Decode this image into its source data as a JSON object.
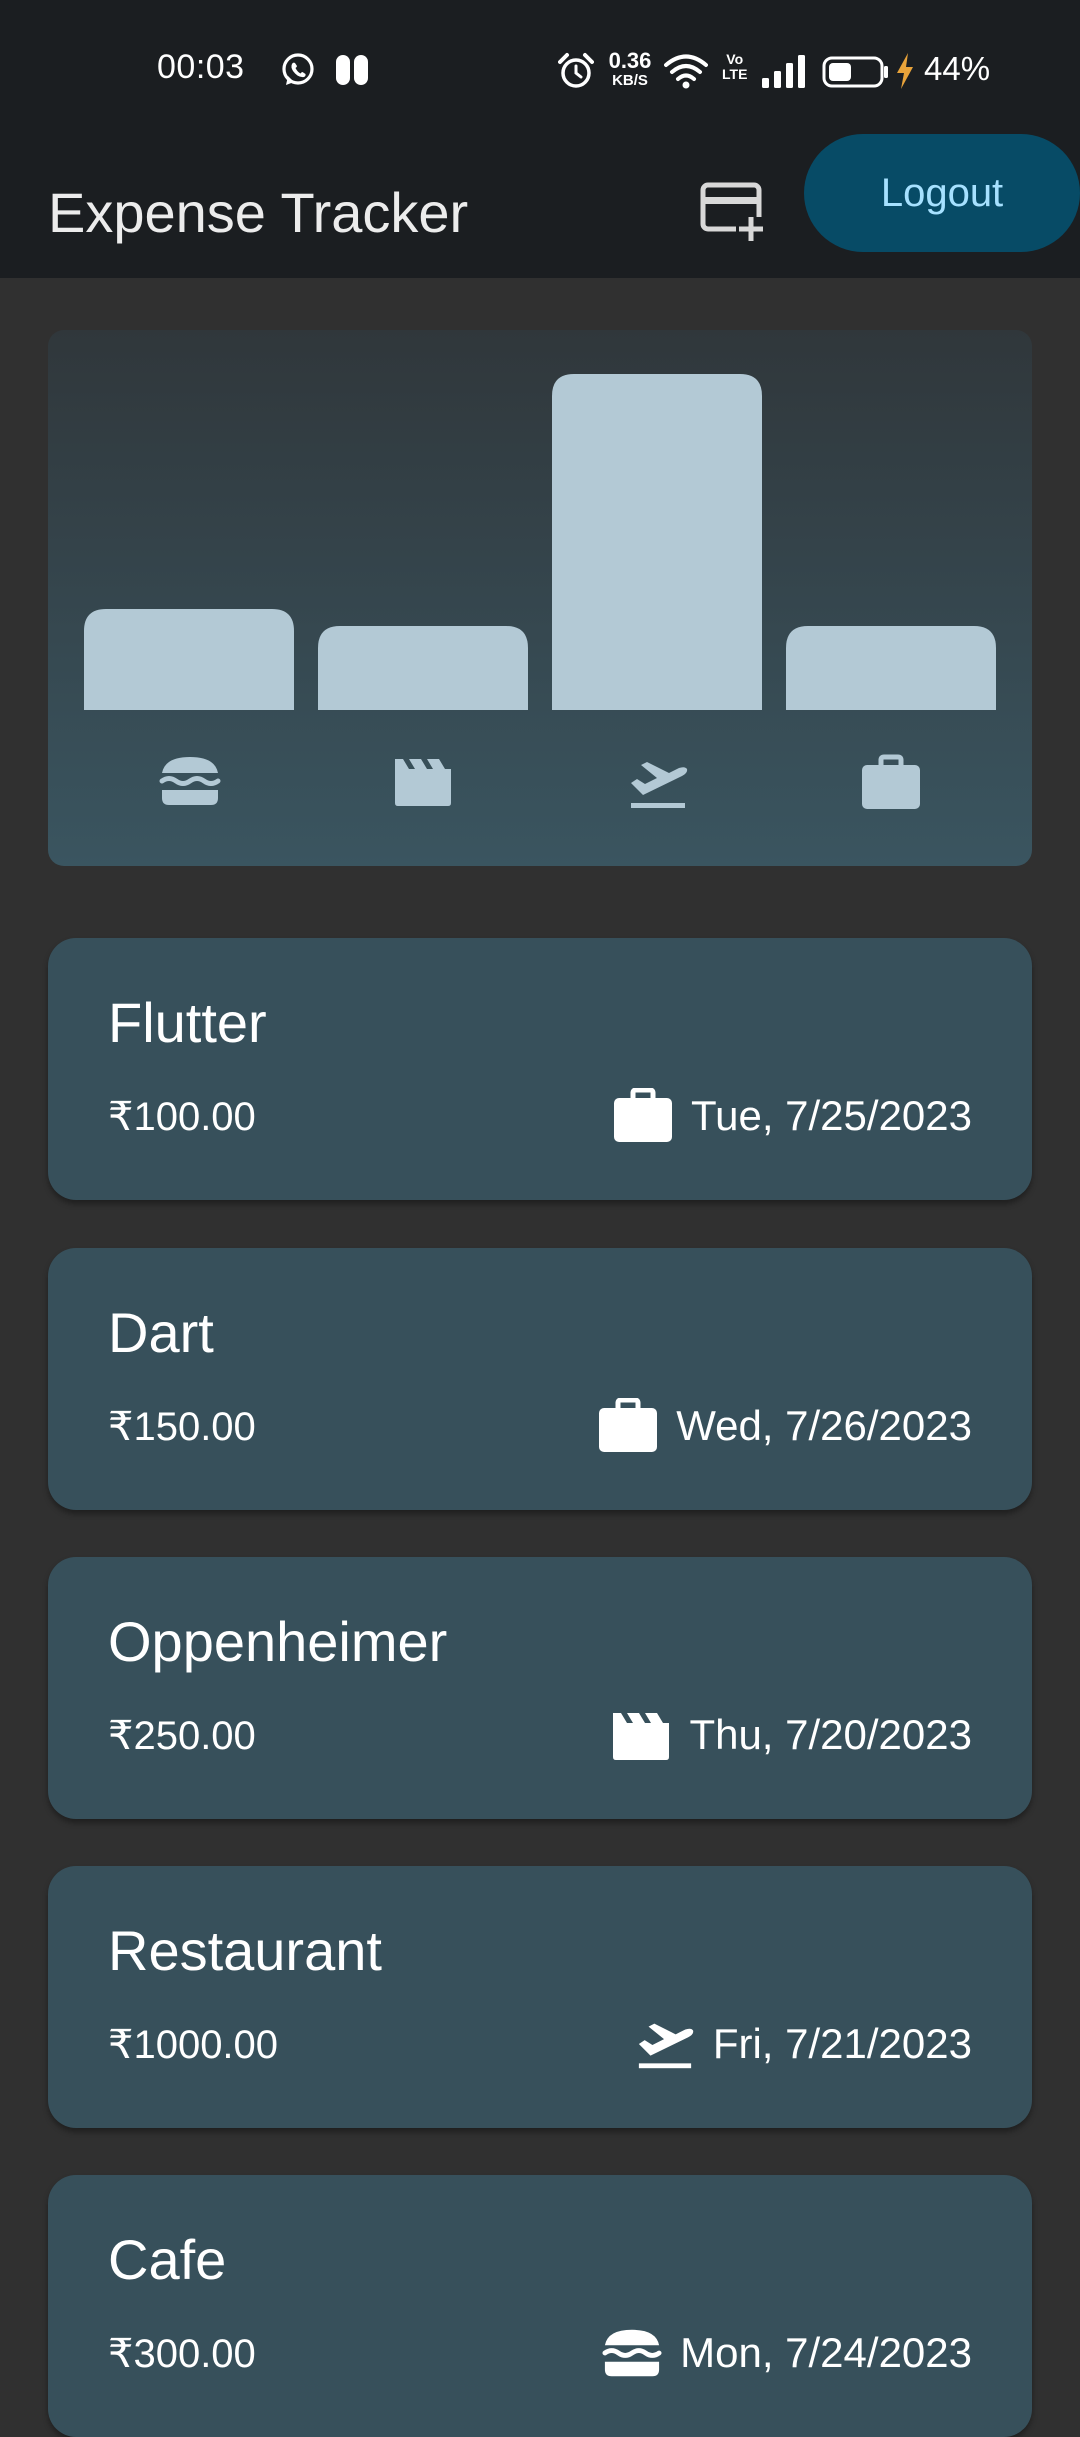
{
  "status_bar": {
    "time": "00:03",
    "net_speed_value": "0.36",
    "net_speed_unit": "KB/S",
    "volte_top": "Vo",
    "volte_bottom": "LTE",
    "battery_percent": "44%",
    "battery_level": 0.44
  },
  "app_bar": {
    "title": "Expense Tracker",
    "add_icon": "add-card-icon",
    "logout_label": "Logout"
  },
  "chart_data": {
    "type": "bar",
    "categories": [
      "food",
      "leisure",
      "travel",
      "work"
    ],
    "category_icons": [
      "hamburger-icon",
      "movie-clapper-icon",
      "flight-takeoff-icon",
      "briefcase-icon"
    ],
    "values": [
      300,
      250,
      1000,
      250
    ],
    "ylim": [
      0,
      1000
    ],
    "grid": false,
    "bar_color": "#b3c9d5"
  },
  "expenses": [
    {
      "title": "Flutter",
      "amount": "₹100.00",
      "category_icon": "briefcase-icon",
      "date": "Tue, 7/25/2023"
    },
    {
      "title": "Dart",
      "amount": "₹150.00",
      "category_icon": "briefcase-icon",
      "date": "Wed, 7/26/2023"
    },
    {
      "title": "Oppenheimer",
      "amount": "₹250.00",
      "category_icon": "movie-clapper-icon",
      "date": "Thu, 7/20/2023"
    },
    {
      "title": "Restaurant",
      "amount": "₹1000.00",
      "category_icon": "flight-takeoff-icon",
      "date": "Fri, 7/21/2023"
    },
    {
      "title": "Cafe",
      "amount": "₹300.00",
      "category_icon": "hamburger-icon",
      "date": "Mon, 7/24/2023"
    }
  ],
  "colors": {
    "app_bar_bg": "#1b1e21",
    "page_bg": "#303030",
    "card_bg": "#37505b",
    "logout_bg": "#074b66",
    "logout_text": "#a6e1ff",
    "charging_bolt": "#e8a33a"
  }
}
